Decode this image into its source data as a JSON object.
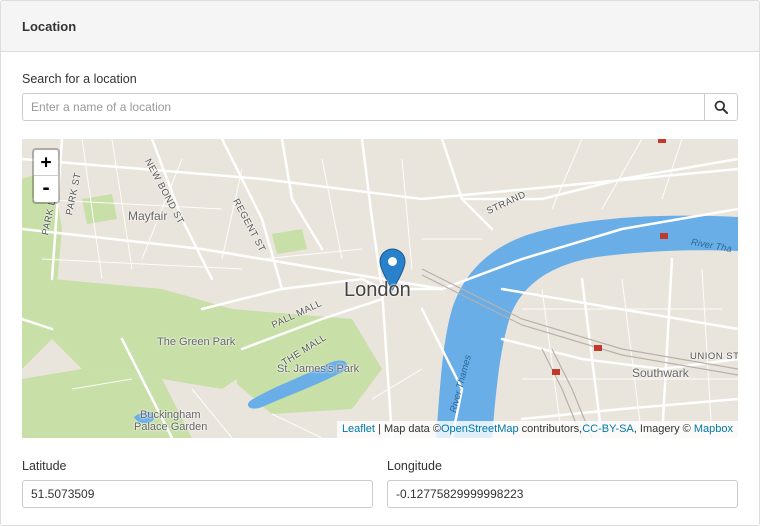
{
  "panel": {
    "title": "Location"
  },
  "search": {
    "label": "Search for a location",
    "placeholder": "Enter a name of a location",
    "button_icon": "search-icon"
  },
  "map": {
    "zoom_in": "+",
    "zoom_out": "-",
    "marker_icon": "map-marker-icon",
    "labels": {
      "city": "London",
      "mayfair": "Mayfair",
      "green_park": "The Green Park",
      "st_james": "St. James's Park",
      "buckingham_1": "Buckingham",
      "buckingham_2": "Palace Garden",
      "southwark": "Southwark",
      "new_bond_st": "NEW BOND ST",
      "regent_st": "REGENT ST",
      "park_ln": "PARK LN",
      "park_st": "PARK ST",
      "strand": "STRAND",
      "pall_mall": "PALL MALL",
      "the_mall": "THE MALL",
      "river_thames_1": "River Thames",
      "river_thames_2": "River Tha",
      "union_st": "UNION ST"
    },
    "attribution": {
      "leaflet": "Leaflet",
      "sep": " | Map data ©",
      "osm": "OpenStreetMap",
      "contributors": " contributors,",
      "license": "CC-BY-SA",
      "imagery": ", Imagery © ",
      "mapbox": "Mapbox"
    },
    "colors": {
      "land": "#e9e4dc",
      "park": "#c8dfa8",
      "water": "#6aaee8",
      "road": "#ffffff",
      "marker": "#2a81cb"
    }
  },
  "latitude": {
    "label": "Latitude",
    "value": "51.5073509"
  },
  "longitude": {
    "label": "Longitude",
    "value": "-0.12775829999998223"
  }
}
